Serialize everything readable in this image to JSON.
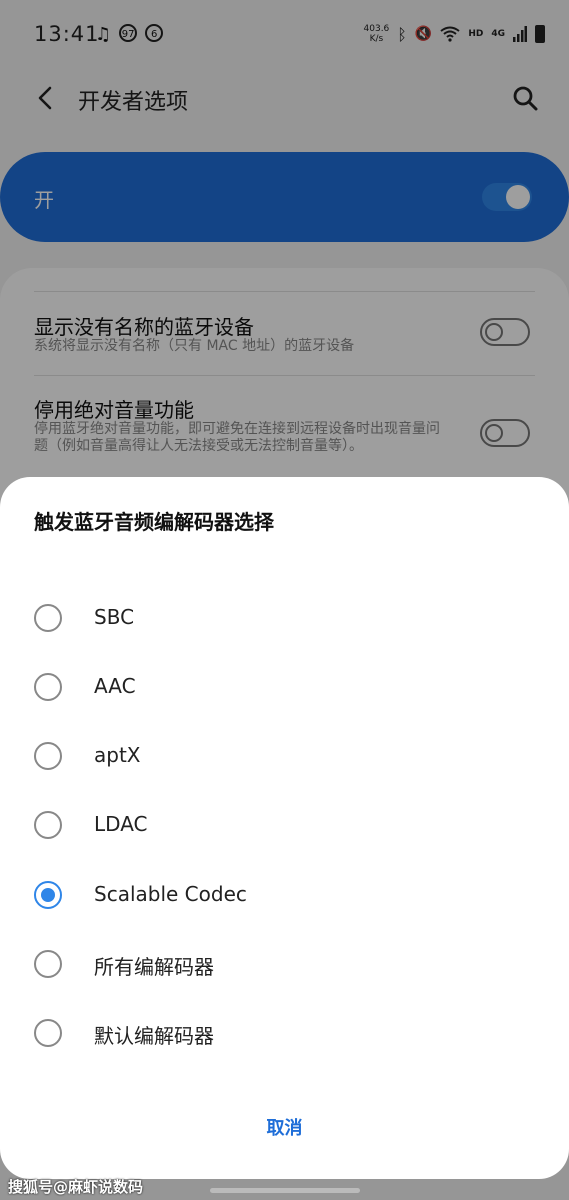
{
  "status_bar": {
    "time": "13:41",
    "notif_badge": "97",
    "speed_value": "403.6",
    "speed_unit": "K/s",
    "network_hd": "HD",
    "network_4g": "4G"
  },
  "header": {
    "title": "开发者选项"
  },
  "master_switch": {
    "label": "开",
    "state": "on"
  },
  "settings": {
    "rows": [
      {
        "title": "显示没有名称的蓝牙设备",
        "subtitle": "系统将显示没有名称（只有 MAC 地址）的蓝牙设备",
        "state": "off"
      },
      {
        "title": "停用绝对音量功能",
        "subtitle": "停用蓝牙绝对音量功能，即可避免在连接到远程设备时出现音量问题（例如音量高得让人无法接受或无法控制音量等）。",
        "state": "off"
      }
    ]
  },
  "dialog": {
    "title": "触发蓝牙音频编解码器选择",
    "options": [
      {
        "label": "SBC",
        "selected": false
      },
      {
        "label": "AAC",
        "selected": false
      },
      {
        "label": "aptX",
        "selected": false
      },
      {
        "label": "LDAC",
        "selected": false
      },
      {
        "label": "Scalable Codec",
        "selected": true
      },
      {
        "label": "所有编解码器",
        "selected": false
      },
      {
        "label": "默认编解码器",
        "selected": false
      }
    ],
    "cancel_label": "取消"
  },
  "watermark": "搜狐号@麻虾说数码",
  "colors": {
    "accent": "#2f86e8",
    "master_bg": "#1f6ed8"
  }
}
